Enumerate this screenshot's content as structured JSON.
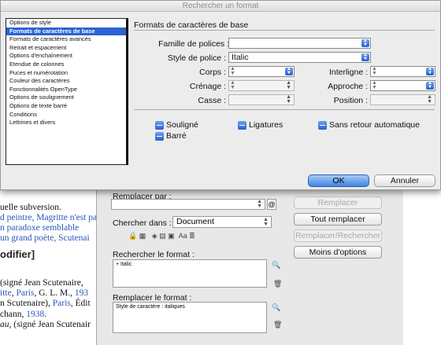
{
  "dialog": {
    "title": "Rechercher un format",
    "section_title": "Formats de caractères de base",
    "categories": [
      "Options de style",
      "Formats de caractères de base",
      "Formats de caractères avancés",
      "Retrait et espacement",
      "Options d'enchaînement",
      "Etendue de colonnes",
      "Puces et numérotation",
      "Couleur des caractères",
      "Fonctionnalités OpenType",
      "Options de soulignement",
      "Options de texte barré",
      "Conditions",
      "Lettrines et divers"
    ],
    "selected_category_index": 1,
    "fields": {
      "font_family_label": "Famille de polices :",
      "font_family_value": "",
      "font_style_label": "Style de police :",
      "font_style_value": "Italic",
      "size_label": "Corps :",
      "size_value": "",
      "leading_label": "Interligne :",
      "leading_value": "",
      "kerning_label": "Crénage :",
      "kerning_value": "",
      "tracking_label": "Approche :",
      "tracking_value": "",
      "case_label": "Casse :",
      "case_value": "",
      "position_label": "Position :",
      "position_value": ""
    },
    "checkboxes": {
      "underline": "Souligné",
      "ligatures": "Ligatures",
      "no_break": "Sans retour automatique",
      "strikethrough": "Barré"
    },
    "ok_label": "OK",
    "cancel_label": "Annuler"
  },
  "find_replace": {
    "replace_label": "Remplacer par :",
    "search_in_label": "Chercher dans :",
    "search_in_value": "Document",
    "find_format_label": "Rechercher le format :",
    "find_format_value": "+ Italic",
    "replace_format_label": "Remplacer le format :",
    "replace_format_value": "Style de caractère : italiques",
    "buttons": {
      "replace": "Remplacer",
      "replace_all": "Tout remplacer",
      "replace_find": "Remplacer/Rechercher",
      "fewer_options": "Moins d'options"
    },
    "option_icons": "Aa"
  },
  "background_page": {
    "line1": "uelle subversion.",
    "line2": "d peintre, Magritte n'est pa",
    "line3": "n  paradoxe  semblable",
    "line4": " un grand poète, Scutenai",
    "heading": "odifier]",
    "ref1a": " (signé Jean Scutenaire,",
    "ref2a": "itte",
    "ref2b": ", ",
    "ref2c": "Paris",
    "ref2d": ", G. L. M., ",
    "ref2e": "193",
    "ref3a": "n Scutenaire), ",
    "ref3b": "Paris",
    "ref3c": ", Édit",
    "ref4a": "chann, ",
    "ref4b": "1938",
    "ref4c": ".",
    "ref5a": "au",
    "ref5b": ", (signé Jean Scutenair"
  },
  "colors": {
    "accent": "#2a63d3",
    "link": "#2a56b8",
    "dialog_bg": "#ececec"
  }
}
